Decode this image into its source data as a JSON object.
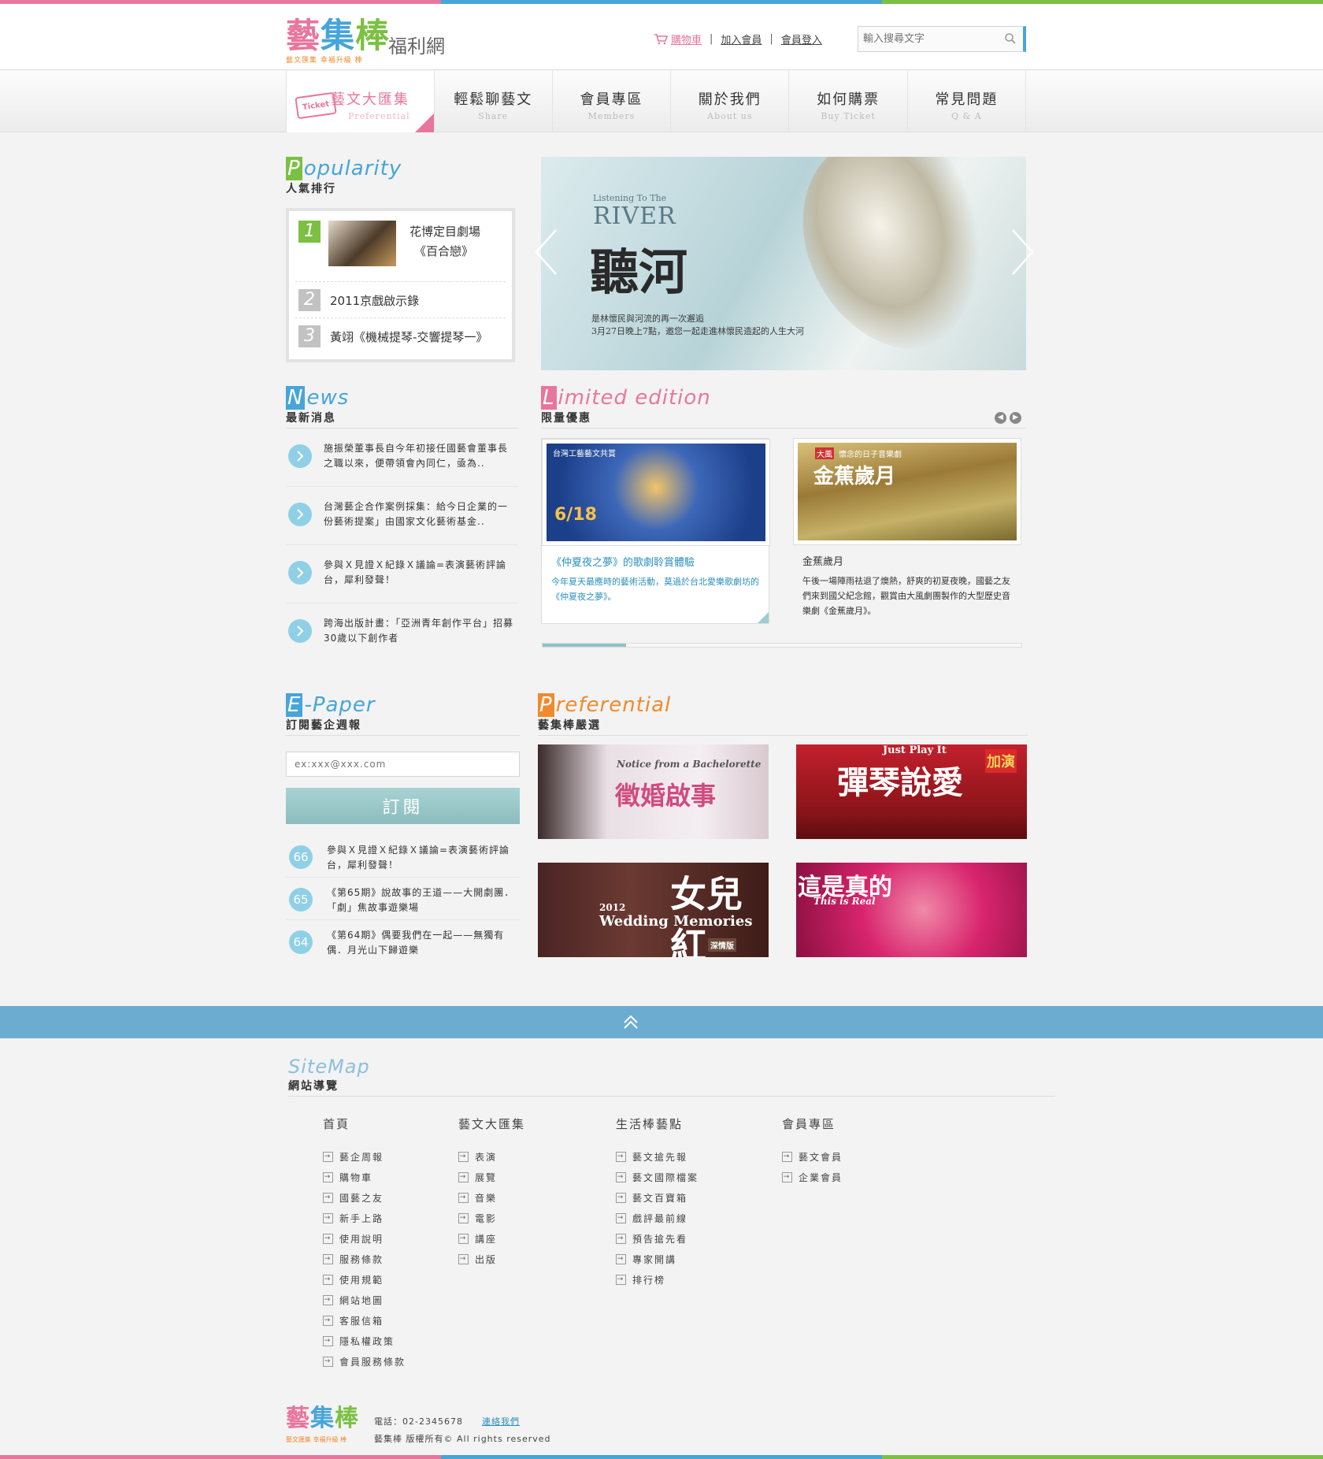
{
  "colors": {
    "pink": "#e8769c",
    "blue": "#46a5d9",
    "green": "#7cc043",
    "orange": "#f08a2d",
    "teal": "#8cbcbd"
  },
  "header": {
    "logo": {
      "part1": "藝",
      "part2": "集",
      "part3": "棒",
      "sub": "藝文匯集 幸福升級 棒",
      "suffix": "福利網"
    },
    "links": {
      "cart": "購物車",
      "join": "加入會員",
      "login": "會員登入",
      "separator": "|"
    },
    "search": {
      "placeholder": "輸入搜尋文字"
    }
  },
  "nav": [
    {
      "zh": "藝文大匯集",
      "en": "Preferential",
      "badge": "Ticket"
    },
    {
      "zh": "輕鬆聊藝文",
      "en": "Share"
    },
    {
      "zh": "會員專區",
      "en": "Members"
    },
    {
      "zh": "關於我們",
      "en": "About us"
    },
    {
      "zh": "如何購票",
      "en": "Buy Ticket"
    },
    {
      "zh": "常見問題",
      "en": "Q & A"
    }
  ],
  "popularity": {
    "title_cap": "P",
    "title_rest": "opularity",
    "subtitle": "人氣排行",
    "items": [
      {
        "rank": "1",
        "title_line1": "花博定目劇場",
        "title_line2": "《百合戀》"
      },
      {
        "rank": "2",
        "title": "2011京戲啟示錄"
      },
      {
        "rank": "3",
        "title": "黃翊《機械提琴-交響提琴一》"
      }
    ]
  },
  "banner": {
    "sub": "Listening To The",
    "en": "RIVER",
    "title": "聽河",
    "desc_line1": "是林懷民與河流的再一次邂逅",
    "desc_line2": "3月27日晚上7點，邀您一起走進林懷民造起的人生大河"
  },
  "news": {
    "title_cap": "N",
    "title_rest": "ews",
    "subtitle": "最新消息",
    "items": [
      "施振榮董事長自今年初接任國藝會董事長之職以來，便帶領會內同仁，亟為..",
      "台灣藝企合作案例採集：給今日企業的一份藝術提案」由國家文化藝術基金..",
      "參與Ｘ見證Ｘ紀錄Ｘ議論=表演藝術評論台，犀利發聲！",
      "跨海出版計畫：「亞洲青年創作平台」招募30歲以下創作者"
    ]
  },
  "limited": {
    "title_cap": "L",
    "title_rest": "imited edition",
    "subtitle": "限量優惠",
    "cards": [
      {
        "title": "《仲夏夜之夢》的歌劇聆賞體驗",
        "desc": "今年夏天最應時的藝術活動，莫過於台北愛樂歌劇坊的《仲夏夜之夢》。",
        "img_tag": "台灣工藝藝文共賞",
        "img_date": "6/18"
      },
      {
        "title": "金蕉歲月",
        "desc": "午後一場陣雨祛退了燠熱，舒爽的初夏夜晚，國藝之友們來到國父紀念館，觀賞由大風劇團製作的大型歷史音樂劇《金蕉歲月》。",
        "img_tag": "大風",
        "img_title": "金蕉歲月",
        "img_caption": "懷念的日子音樂劇"
      }
    ]
  },
  "epaper": {
    "title_cap": "E",
    "title_rest": "-Paper",
    "subtitle": "訂閱藝企週報",
    "input_placeholder": "ex:xxx@xxx.com",
    "button": "訂閱",
    "items": [
      {
        "no": "66",
        "text": "參與Ｘ見證Ｘ紀錄Ｘ議論=表演藝術評論台，犀利發聲！"
      },
      {
        "no": "65",
        "text": "《第65期》說故事的王道——大開劇團．「劇」焦故事遊樂場"
      },
      {
        "no": "64",
        "text": "《第64期》偶要我們在一起——無獨有偶．月光山下歸遊樂"
      }
    ]
  },
  "preferential": {
    "title_cap": "P",
    "title_rest": "referential",
    "subtitle": "藝集棒嚴選",
    "items": [
      {
        "title": "徵婚啟事",
        "en": "Notice from a Bachelorette"
      },
      {
        "title": "彈琴說愛",
        "en": "Just Play It",
        "side": "加演"
      },
      {
        "title": "女兒紅",
        "en": "Wedding Memories",
        "year": "2012",
        "tag": "深情版"
      },
      {
        "title": "這是真的",
        "en": "This is Real"
      }
    ]
  },
  "sitemap": {
    "en": "SiteMap",
    "zh": "網站導覽",
    "columns": [
      {
        "title": "首頁",
        "items": [
          "藝企周報",
          "購物車",
          "國藝之友",
          "新手上路",
          "使用說明",
          "服務條款",
          "使用規範",
          "網站地圖",
          "客服信箱",
          "隱私權政策",
          "會員服務條款"
        ]
      },
      {
        "title": "藝文大匯集",
        "items": [
          "表演",
          "展覽",
          "音樂",
          "電影",
          "講座",
          "出版"
        ]
      },
      {
        "title": "生活棒藝點",
        "items": [
          "藝文搶先報",
          "藝文國際檔案",
          "藝文百寶箱",
          "戲評最前線",
          "預告搶先看",
          "專家開講",
          "排行榜"
        ]
      },
      {
        "title": "會員專區",
        "items": [
          "藝文會員",
          "企業會員"
        ]
      }
    ]
  },
  "footer": {
    "phone": "電話：02-2345678",
    "contact": "連絡我們",
    "copyright": "藝集棒 版權所有© All rights reserved",
    "sub": "藝文匯集 幸福升級 棒"
  }
}
